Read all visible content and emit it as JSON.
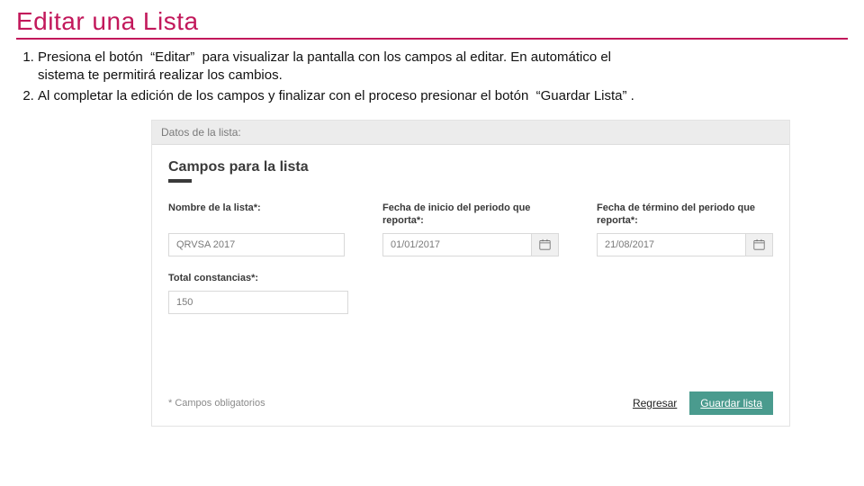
{
  "title": "Editar una Lista",
  "steps": {
    "s1a": "Presiona el botón  “Editar”  para visualizar la pantalla con los campos al editar. En automático el",
    "s1b": "sistema te permitirá realizar los cambios.",
    "s2": "Al completar la edición de los campos y finalizar con el proceso presionar el botón  “Guardar Lista” ."
  },
  "panel_header": "Datos de la lista:",
  "section_title": "Campos para la lista",
  "fields": {
    "name": {
      "label": "Nombre de la lista*:",
      "value": "QRVSA 2017"
    },
    "start": {
      "label": "Fecha de inicio del periodo que reporta*:",
      "value": "01/01/2017"
    },
    "end": {
      "label": "Fecha de término del periodo que reporta*:",
      "value": "21/08/2017"
    },
    "total": {
      "label": "Total constancias*:",
      "value": "150"
    }
  },
  "footnote": "* Campos obligatorios",
  "actions": {
    "back": "Regresar",
    "save": "Guardar lista"
  }
}
